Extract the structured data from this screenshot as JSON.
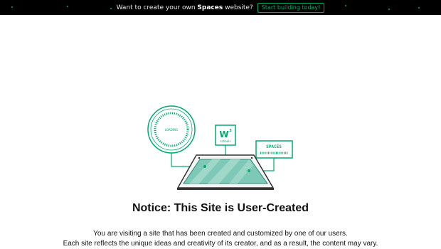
{
  "banner": {
    "prefix": "Want to create your own",
    "highlight": "Spaces",
    "suffix": "website?",
    "cta_label": "Start building today!"
  },
  "illustration": {
    "loading_label": "LOADING",
    "w3_label": "W",
    "w3_superscript": "3",
    "w3_caption": "schools",
    "spaces_label": "SPACES"
  },
  "notice": {
    "title": "Notice: This Site is User-Created",
    "line1": "You are visiting a site that has been created and customized by one of our users.",
    "line2": "Each site reflects the unique ideas and creativity of its creator, and as a result, the content may vary."
  },
  "colors": {
    "accent": "#04aa6d",
    "banner_bg": "#000000",
    "device_glass": "#7ec8b8"
  }
}
